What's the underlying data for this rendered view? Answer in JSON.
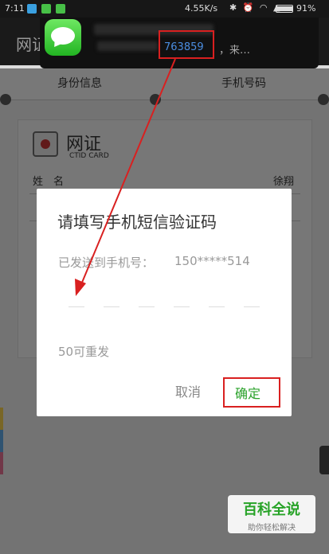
{
  "status_bar": {
    "time": "7:11",
    "network_speed": "4.55K/s",
    "battery_percent": "91%",
    "battery_level": 0.91,
    "icons": [
      "notification-app-icon",
      "message-icon",
      "message-icon",
      "bluetooth-icon",
      "alarm-icon",
      "wifi-icon",
      "signal-icon",
      "battery-icon"
    ]
  },
  "header": {
    "title": "网证"
  },
  "notification": {
    "code": "763859",
    "suffix": "，来…"
  },
  "tabs": [
    {
      "label": "身份信息"
    },
    {
      "label": "手机号码"
    }
  ],
  "card": {
    "brand": "网证",
    "brand_sub": "CTID CARD",
    "name_label": "姓　名",
    "name_value": "徐翔"
  },
  "dialog": {
    "title": "请填写手机短信验证码",
    "phone_label": "已发送到手机号：",
    "phone_masked": "150*****514",
    "resend": "50可重发",
    "cancel_label": "取消",
    "confirm_label": "确定",
    "code_slots": 6
  },
  "watermark": {
    "title": "百科全说",
    "subtitle": "助你轻松解决"
  },
  "colors": {
    "accent_green": "#2aa12a",
    "annotation_red": "#d92020",
    "code_blue": "#4b8de0"
  }
}
